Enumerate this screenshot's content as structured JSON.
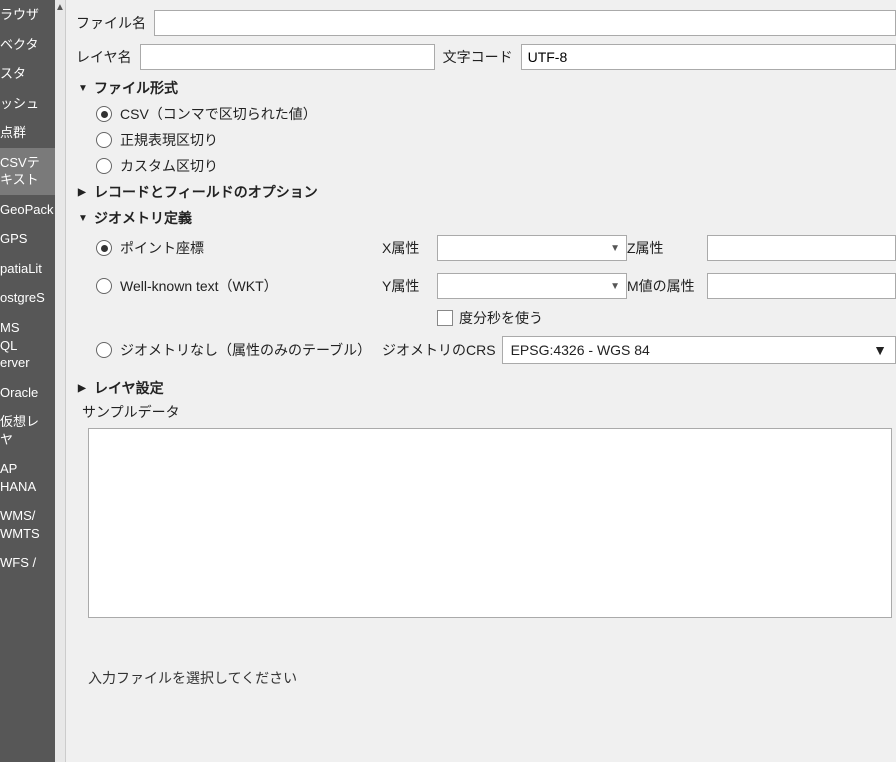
{
  "sidebar": {
    "items": [
      {
        "label": "ラウザ"
      },
      {
        "label": "ベクタ"
      },
      {
        "label": "スタ"
      },
      {
        "label": "ッシュ"
      },
      {
        "label": "点群"
      },
      {
        "label": "CSVテ\nキスト",
        "selected": true
      },
      {
        "label": "GeoPack"
      },
      {
        "label": "GPS"
      },
      {
        "label": "patiaLit"
      },
      {
        "label": "ostgreS"
      },
      {
        "label": "MS\nQL\nerver"
      },
      {
        "label": "Oracle"
      },
      {
        "label": "仮想レ\nヤ"
      },
      {
        "label": "AP\nHANA"
      },
      {
        "label": "WMS/\nWMTS"
      },
      {
        "label": "WFS /"
      }
    ]
  },
  "form": {
    "file_name_label": "ファイル名",
    "file_name_value": "",
    "layer_name_label": "レイヤ名",
    "layer_name_value": "",
    "encoding_label": "文字コード",
    "encoding_value": "UTF-8"
  },
  "sections": {
    "file_format": {
      "title": "ファイル形式",
      "options": [
        {
          "label": "CSV（コンマで区切られた値）",
          "checked": true
        },
        {
          "label": "正規表現区切り",
          "checked": false
        },
        {
          "label": "カスタム区切り",
          "checked": false
        }
      ]
    },
    "record_fields": {
      "title": "レコードとフィールドのオプション"
    },
    "geometry": {
      "title": "ジオメトリ定義",
      "options": [
        {
          "label": "ポイント座標",
          "checked": true
        },
        {
          "label": "Well-known text（WKT）",
          "checked": false
        },
        {
          "label": "ジオメトリなし（属性のみのテーブル）",
          "checked": false
        }
      ],
      "x_label": "X属性",
      "y_label": "Y属性",
      "z_label": "Z属性",
      "m_label": "M値の属性",
      "dms_label": "度分秒を使う",
      "crs_label": "ジオメトリのCRS",
      "crs_value": "EPSG:4326 - WGS 84"
    },
    "layer_settings": {
      "title": "レイヤ設定"
    },
    "sample": {
      "title": "サンプルデータ"
    }
  },
  "status": "入力ファイルを選択してください"
}
